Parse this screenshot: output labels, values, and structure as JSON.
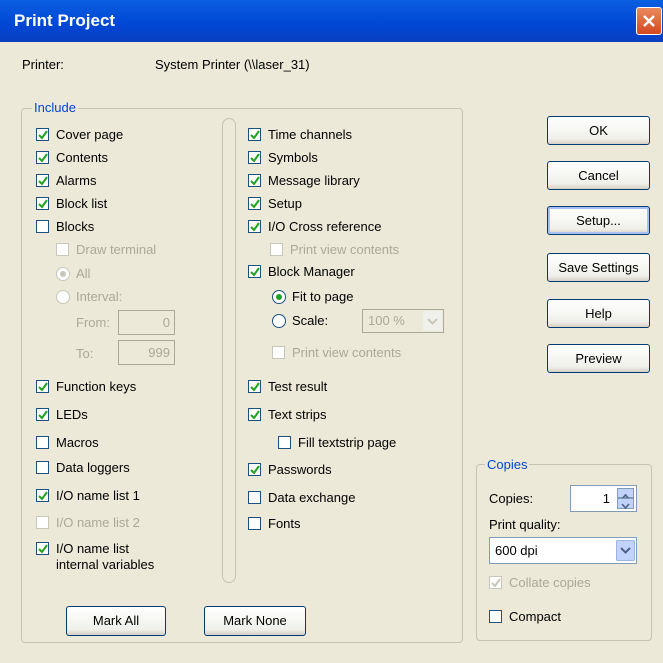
{
  "window": {
    "title": "Print Project"
  },
  "printer": {
    "label": "Printer:",
    "value": "System Printer (\\\\laser_31)"
  },
  "include": {
    "title": "Include",
    "left": [
      {
        "label": "Cover page",
        "checked": true,
        "enabled": true
      },
      {
        "label": "Contents",
        "checked": true,
        "enabled": true
      },
      {
        "label": "Alarms",
        "checked": true,
        "enabled": true
      },
      {
        "label": "Block list",
        "checked": true,
        "enabled": true
      },
      {
        "label": "Blocks",
        "checked": false,
        "enabled": true
      }
    ],
    "blocks_options": {
      "draw_terminal": "Draw terminal",
      "all": "All",
      "interval": "Interval:",
      "from_label": "From:",
      "from_value": "0",
      "to_label": "To:",
      "to_value": "999"
    },
    "left2": [
      {
        "label": "Function keys",
        "checked": true,
        "enabled": true
      },
      {
        "label": "LEDs",
        "checked": true,
        "enabled": true
      },
      {
        "label": "Macros",
        "checked": false,
        "enabled": true
      },
      {
        "label": "Data loggers",
        "checked": false,
        "enabled": true
      },
      {
        "label": "I/O name list 1",
        "checked": true,
        "enabled": true
      },
      {
        "label": "I/O name list 2",
        "checked": false,
        "enabled": false
      },
      {
        "label": "I/O name list",
        "label2": "internal variables",
        "checked": true,
        "enabled": true
      }
    ],
    "right": [
      {
        "label": "Time channels",
        "checked": true,
        "enabled": true
      },
      {
        "label": "Symbols",
        "checked": true,
        "enabled": true
      },
      {
        "label": "Message library",
        "checked": true,
        "enabled": true
      },
      {
        "label": "Setup",
        "checked": true,
        "enabled": true
      },
      {
        "label": "I/O Cross reference",
        "checked": true,
        "enabled": true
      }
    ],
    "print_view_contents_1": "Print view contents",
    "block_manager": {
      "label": "Block Manager",
      "checked": true
    },
    "fit_to_page": "Fit to page",
    "scale": "Scale:",
    "scale_value": "100 %",
    "print_view_contents_2": "Print view contents",
    "right2": [
      {
        "label": "Test result",
        "checked": true
      },
      {
        "label": "Text strips",
        "checked": true
      }
    ],
    "fill_textstrip": "Fill textstrip page",
    "right3": [
      {
        "label": "Passwords",
        "checked": true
      },
      {
        "label": "Data exchange",
        "checked": false
      },
      {
        "label": "Fonts",
        "checked": false
      }
    ],
    "mark_all": "Mark All",
    "mark_none": "Mark None"
  },
  "buttons": {
    "ok": "OK",
    "cancel": "Cancel",
    "setup": "Setup...",
    "save_settings": "Save Settings",
    "help": "Help",
    "preview": "Preview"
  },
  "copies": {
    "title": "Copies",
    "copies_label": "Copies:",
    "copies_value": "1",
    "quality_label": "Print quality:",
    "quality_value": "600 dpi",
    "collate": "Collate copies",
    "compact": "Compact"
  },
  "colors": {
    "accent": "#0046d5",
    "check": "#21a121",
    "close": "#d4481f"
  }
}
